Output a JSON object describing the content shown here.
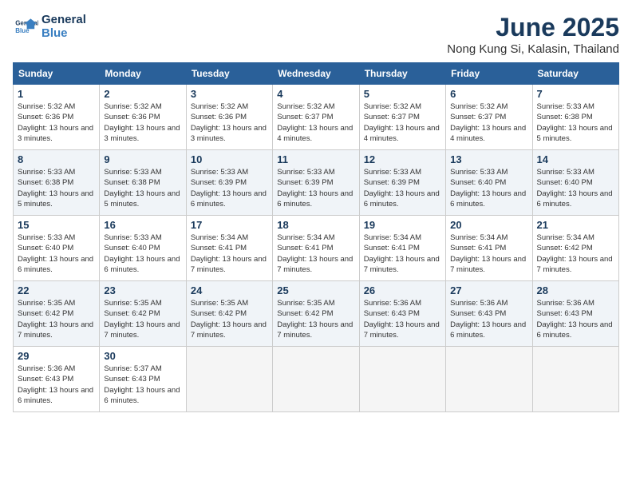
{
  "header": {
    "logo_line1": "General",
    "logo_line2": "Blue",
    "month": "June 2025",
    "location": "Nong Kung Si, Kalasin, Thailand"
  },
  "days_of_week": [
    "Sunday",
    "Monday",
    "Tuesday",
    "Wednesday",
    "Thursday",
    "Friday",
    "Saturday"
  ],
  "weeks": [
    [
      {
        "day": "1",
        "sunrise": "Sunrise: 5:32 AM",
        "sunset": "Sunset: 6:36 PM",
        "daylight": "Daylight: 13 hours and 3 minutes."
      },
      {
        "day": "2",
        "sunrise": "Sunrise: 5:32 AM",
        "sunset": "Sunset: 6:36 PM",
        "daylight": "Daylight: 13 hours and 3 minutes."
      },
      {
        "day": "3",
        "sunrise": "Sunrise: 5:32 AM",
        "sunset": "Sunset: 6:36 PM",
        "daylight": "Daylight: 13 hours and 3 minutes."
      },
      {
        "day": "4",
        "sunrise": "Sunrise: 5:32 AM",
        "sunset": "Sunset: 6:37 PM",
        "daylight": "Daylight: 13 hours and 4 minutes."
      },
      {
        "day": "5",
        "sunrise": "Sunrise: 5:32 AM",
        "sunset": "Sunset: 6:37 PM",
        "daylight": "Daylight: 13 hours and 4 minutes."
      },
      {
        "day": "6",
        "sunrise": "Sunrise: 5:32 AM",
        "sunset": "Sunset: 6:37 PM",
        "daylight": "Daylight: 13 hours and 4 minutes."
      },
      {
        "day": "7",
        "sunrise": "Sunrise: 5:33 AM",
        "sunset": "Sunset: 6:38 PM",
        "daylight": "Daylight: 13 hours and 5 minutes."
      }
    ],
    [
      {
        "day": "8",
        "sunrise": "Sunrise: 5:33 AM",
        "sunset": "Sunset: 6:38 PM",
        "daylight": "Daylight: 13 hours and 5 minutes."
      },
      {
        "day": "9",
        "sunrise": "Sunrise: 5:33 AM",
        "sunset": "Sunset: 6:38 PM",
        "daylight": "Daylight: 13 hours and 5 minutes."
      },
      {
        "day": "10",
        "sunrise": "Sunrise: 5:33 AM",
        "sunset": "Sunset: 6:39 PM",
        "daylight": "Daylight: 13 hours and 6 minutes."
      },
      {
        "day": "11",
        "sunrise": "Sunrise: 5:33 AM",
        "sunset": "Sunset: 6:39 PM",
        "daylight": "Daylight: 13 hours and 6 minutes."
      },
      {
        "day": "12",
        "sunrise": "Sunrise: 5:33 AM",
        "sunset": "Sunset: 6:39 PM",
        "daylight": "Daylight: 13 hours and 6 minutes."
      },
      {
        "day": "13",
        "sunrise": "Sunrise: 5:33 AM",
        "sunset": "Sunset: 6:40 PM",
        "daylight": "Daylight: 13 hours and 6 minutes."
      },
      {
        "day": "14",
        "sunrise": "Sunrise: 5:33 AM",
        "sunset": "Sunset: 6:40 PM",
        "daylight": "Daylight: 13 hours and 6 minutes."
      }
    ],
    [
      {
        "day": "15",
        "sunrise": "Sunrise: 5:33 AM",
        "sunset": "Sunset: 6:40 PM",
        "daylight": "Daylight: 13 hours and 6 minutes."
      },
      {
        "day": "16",
        "sunrise": "Sunrise: 5:33 AM",
        "sunset": "Sunset: 6:40 PM",
        "daylight": "Daylight: 13 hours and 6 minutes."
      },
      {
        "day": "17",
        "sunrise": "Sunrise: 5:34 AM",
        "sunset": "Sunset: 6:41 PM",
        "daylight": "Daylight: 13 hours and 7 minutes."
      },
      {
        "day": "18",
        "sunrise": "Sunrise: 5:34 AM",
        "sunset": "Sunset: 6:41 PM",
        "daylight": "Daylight: 13 hours and 7 minutes."
      },
      {
        "day": "19",
        "sunrise": "Sunrise: 5:34 AM",
        "sunset": "Sunset: 6:41 PM",
        "daylight": "Daylight: 13 hours and 7 minutes."
      },
      {
        "day": "20",
        "sunrise": "Sunrise: 5:34 AM",
        "sunset": "Sunset: 6:41 PM",
        "daylight": "Daylight: 13 hours and 7 minutes."
      },
      {
        "day": "21",
        "sunrise": "Sunrise: 5:34 AM",
        "sunset": "Sunset: 6:42 PM",
        "daylight": "Daylight: 13 hours and 7 minutes."
      }
    ],
    [
      {
        "day": "22",
        "sunrise": "Sunrise: 5:35 AM",
        "sunset": "Sunset: 6:42 PM",
        "daylight": "Daylight: 13 hours and 7 minutes."
      },
      {
        "day": "23",
        "sunrise": "Sunrise: 5:35 AM",
        "sunset": "Sunset: 6:42 PM",
        "daylight": "Daylight: 13 hours and 7 minutes."
      },
      {
        "day": "24",
        "sunrise": "Sunrise: 5:35 AM",
        "sunset": "Sunset: 6:42 PM",
        "daylight": "Daylight: 13 hours and 7 minutes."
      },
      {
        "day": "25",
        "sunrise": "Sunrise: 5:35 AM",
        "sunset": "Sunset: 6:42 PM",
        "daylight": "Daylight: 13 hours and 7 minutes."
      },
      {
        "day": "26",
        "sunrise": "Sunrise: 5:36 AM",
        "sunset": "Sunset: 6:43 PM",
        "daylight": "Daylight: 13 hours and 7 minutes."
      },
      {
        "day": "27",
        "sunrise": "Sunrise: 5:36 AM",
        "sunset": "Sunset: 6:43 PM",
        "daylight": "Daylight: 13 hours and 6 minutes."
      },
      {
        "day": "28",
        "sunrise": "Sunrise: 5:36 AM",
        "sunset": "Sunset: 6:43 PM",
        "daylight": "Daylight: 13 hours and 6 minutes."
      }
    ],
    [
      {
        "day": "29",
        "sunrise": "Sunrise: 5:36 AM",
        "sunset": "Sunset: 6:43 PM",
        "daylight": "Daylight: 13 hours and 6 minutes."
      },
      {
        "day": "30",
        "sunrise": "Sunrise: 5:37 AM",
        "sunset": "Sunset: 6:43 PM",
        "daylight": "Daylight: 13 hours and 6 minutes."
      },
      null,
      null,
      null,
      null,
      null
    ]
  ]
}
